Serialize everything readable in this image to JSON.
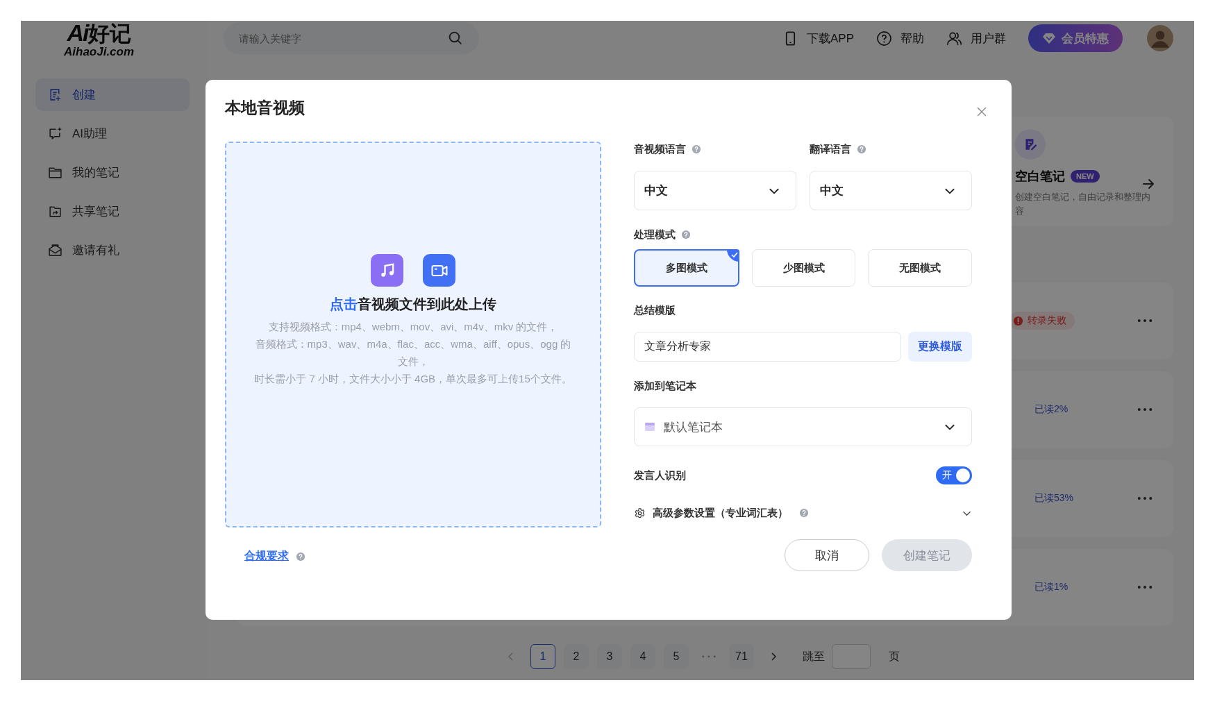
{
  "header": {
    "logo": {
      "mark": "Ai",
      "name": "好记",
      "domain": "AihaoJi.com"
    },
    "search": {
      "placeholder": "请输入关键字"
    },
    "links": [
      {
        "label": "下载APP",
        "kind": "phone"
      },
      {
        "label": "帮助",
        "kind": "help"
      },
      {
        "label": "用户群",
        "kind": "group"
      }
    ],
    "vip_button": "会员特惠"
  },
  "sidebar": {
    "items": [
      {
        "label": "创建",
        "kind": "create",
        "selected": true
      },
      {
        "label": "AI助理",
        "kind": "chat",
        "selected": false
      },
      {
        "label": "我的笔记",
        "kind": "folder",
        "selected": false
      },
      {
        "label": "共享笔记",
        "kind": "shared",
        "selected": false
      },
      {
        "label": "邀请有礼",
        "kind": "gift",
        "selected": false
      }
    ]
  },
  "create_card": {
    "title": "空白笔记",
    "badge": "NEW",
    "description": "创建空白笔记，自由记录和整理内容"
  },
  "notes": [
    {
      "kind": "failed",
      "status": "转录失败"
    },
    {
      "kind": "progress",
      "status": "已读2%"
    },
    {
      "kind": "progress",
      "status": "已读53%"
    },
    {
      "kind": "progress",
      "status": "已读1%"
    }
  ],
  "pagination": {
    "pages": [
      {
        "label": "1",
        "selected": true
      },
      {
        "label": "2",
        "selected": false
      },
      {
        "label": "3",
        "selected": false
      },
      {
        "label": "4",
        "selected": false
      },
      {
        "label": "5",
        "selected": false
      }
    ],
    "last_page": {
      "label": "71",
      "selected": false
    },
    "prev_disabled": true,
    "jump_label": "跳至",
    "page_unit": "页"
  },
  "modal": {
    "title": "本地音视频",
    "upload": {
      "link": "点击",
      "prompt": "音视频文件到此处上传",
      "hints": [
        "支持视频格式：mp4、webm、mov、avi、m4v、mkv 的文件，",
        "音频格式：mp3、wav、m4a、flac、acc、wma、aiff、opus、ogg 的文件，",
        "时长需小于 7 小时，文件大小小于 4GB，单次最多可上传15个文件。"
      ]
    },
    "language": {
      "label": "音视频语言",
      "help": true,
      "value": "中文"
    },
    "translation": {
      "label": "翻译语言",
      "help": true,
      "value": "中文"
    },
    "mode": {
      "label": "处理模式",
      "help": true,
      "options": [
        {
          "label": "多图模式",
          "selected": true
        },
        {
          "label": "少图模式",
          "selected": false
        },
        {
          "label": "无图模式",
          "selected": false
        }
      ]
    },
    "template": {
      "label": "总结模版",
      "value": "文章分析专家",
      "button": "更换模版"
    },
    "notebook": {
      "label": "添加到笔记本",
      "value": "默认笔记本"
    },
    "speaker": {
      "label": "发言人识别",
      "on": true,
      "on_label": "开"
    },
    "advanced": {
      "label": "高级参数设置（专业词汇表）",
      "help": true,
      "expanded": false
    },
    "footer": {
      "link": "合规要求",
      "help": true,
      "cancel": "取消",
      "submit": "创建笔记",
      "submit_disabled": true
    }
  }
}
